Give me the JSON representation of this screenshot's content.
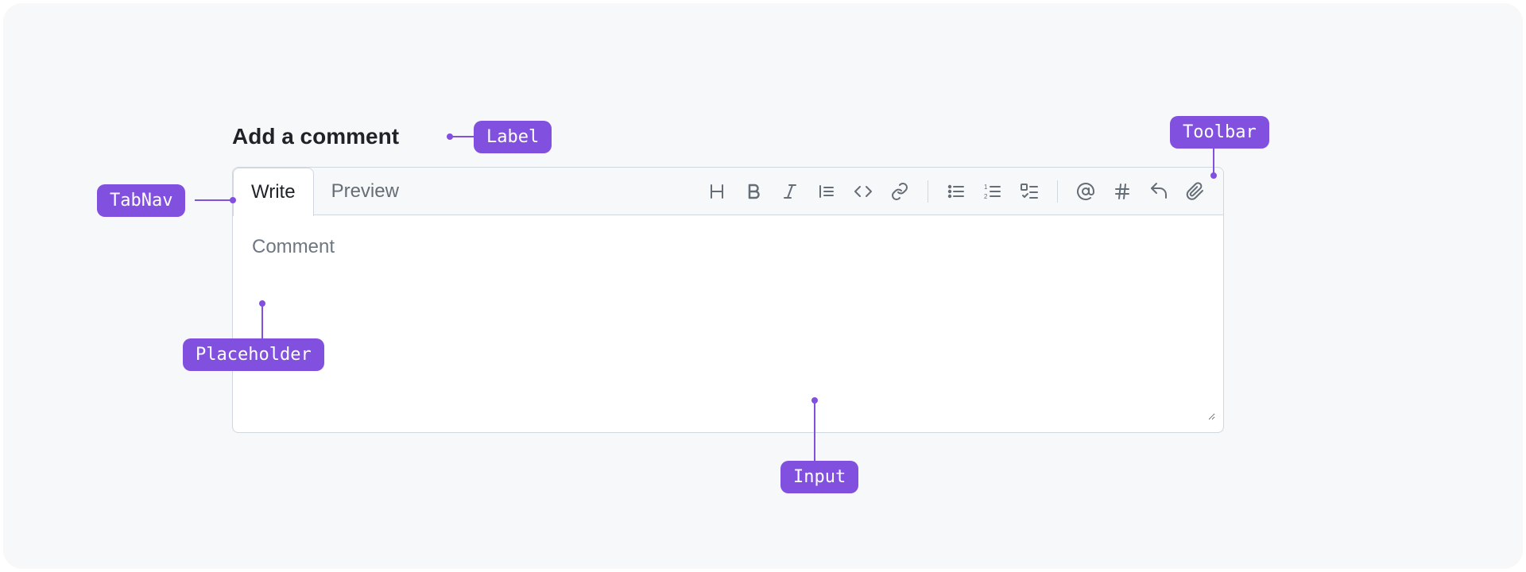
{
  "header": {
    "label": "Add a comment"
  },
  "tabs": {
    "write": "Write",
    "preview": "Preview",
    "active": "write"
  },
  "toolbar": {
    "items": [
      {
        "name": "heading-icon"
      },
      {
        "name": "bold-icon"
      },
      {
        "name": "italic-icon"
      },
      {
        "name": "quote-icon"
      },
      {
        "name": "code-icon"
      },
      {
        "name": "link-icon"
      },
      {
        "sep": true
      },
      {
        "name": "bulleted-list-icon"
      },
      {
        "name": "numbered-list-icon"
      },
      {
        "name": "task-list-icon"
      },
      {
        "sep": true
      },
      {
        "name": "mention-icon"
      },
      {
        "name": "reference-icon"
      },
      {
        "name": "reply-icon"
      },
      {
        "name": "attach-icon"
      }
    ]
  },
  "input": {
    "placeholder": "Comment",
    "value": ""
  },
  "annotations": {
    "label": "Label",
    "tabnav": "TabNav",
    "toolbar": "Toolbar",
    "placeholder": "Placeholder",
    "input": "Input"
  },
  "colors": {
    "accent": "#8250df",
    "border": "#d0d7de",
    "muted": "#656d76",
    "fg": "#1f2328",
    "subtle_bg": "#f6f8fa"
  }
}
